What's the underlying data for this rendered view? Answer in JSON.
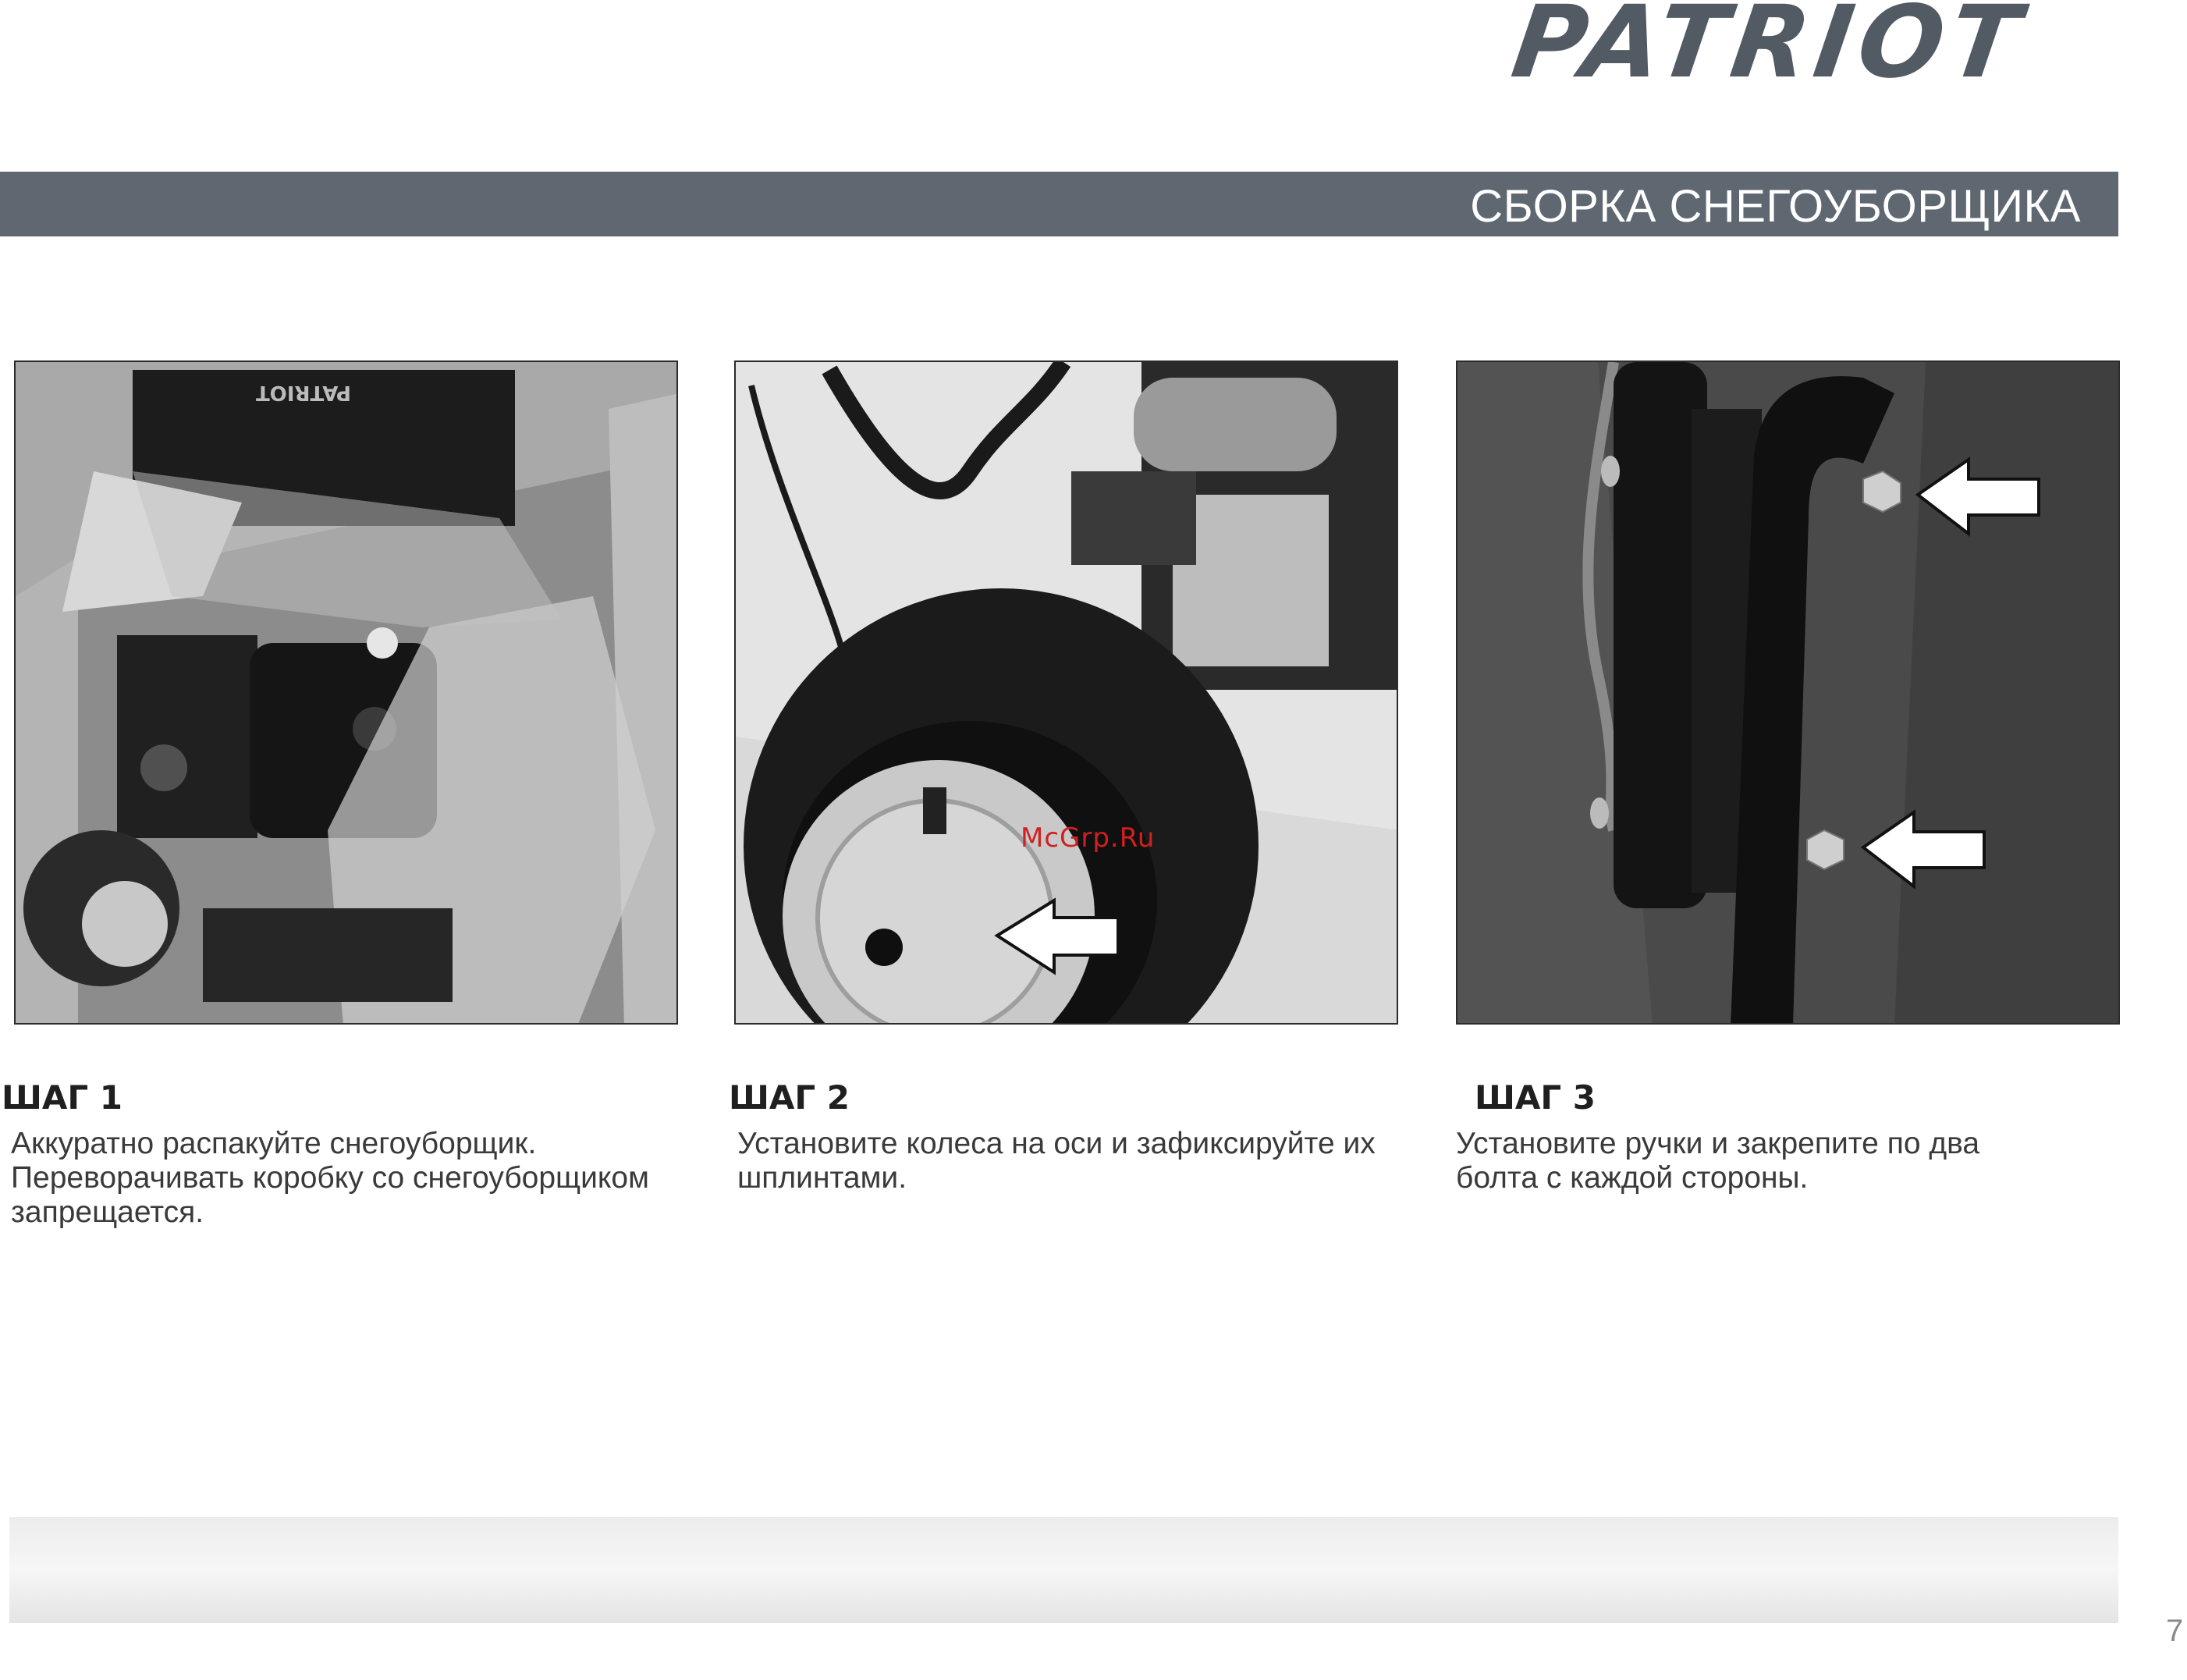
{
  "brand": {
    "logo_text": "PATRIOT"
  },
  "section": {
    "title": "СБОРКА СНЕГОУБОРЩИКА"
  },
  "steps": [
    {
      "title": "ШАГ 1",
      "text": "Аккуратно распакуйте снегоуборщик.\nПереворачивать коробку со снегоуборщиком\nзапрещается."
    },
    {
      "title": "ШАГ 2",
      "text": "Установите колеса на оси и зафиксируйте их\nшплинтами."
    },
    {
      "title": "ШАГ 3",
      "text": "Установите ручки и закрепите по два\nболта с каждой стороны."
    }
  ],
  "photos": [
    {
      "box_label": "PATRIOT"
    },
    {
      "watermark": "McGrp.Ru"
    },
    {}
  ],
  "page": {
    "number": "7"
  },
  "colors": {
    "header_bar": "#5f6870",
    "logo": "#525a63",
    "watermark": "#d02020"
  }
}
